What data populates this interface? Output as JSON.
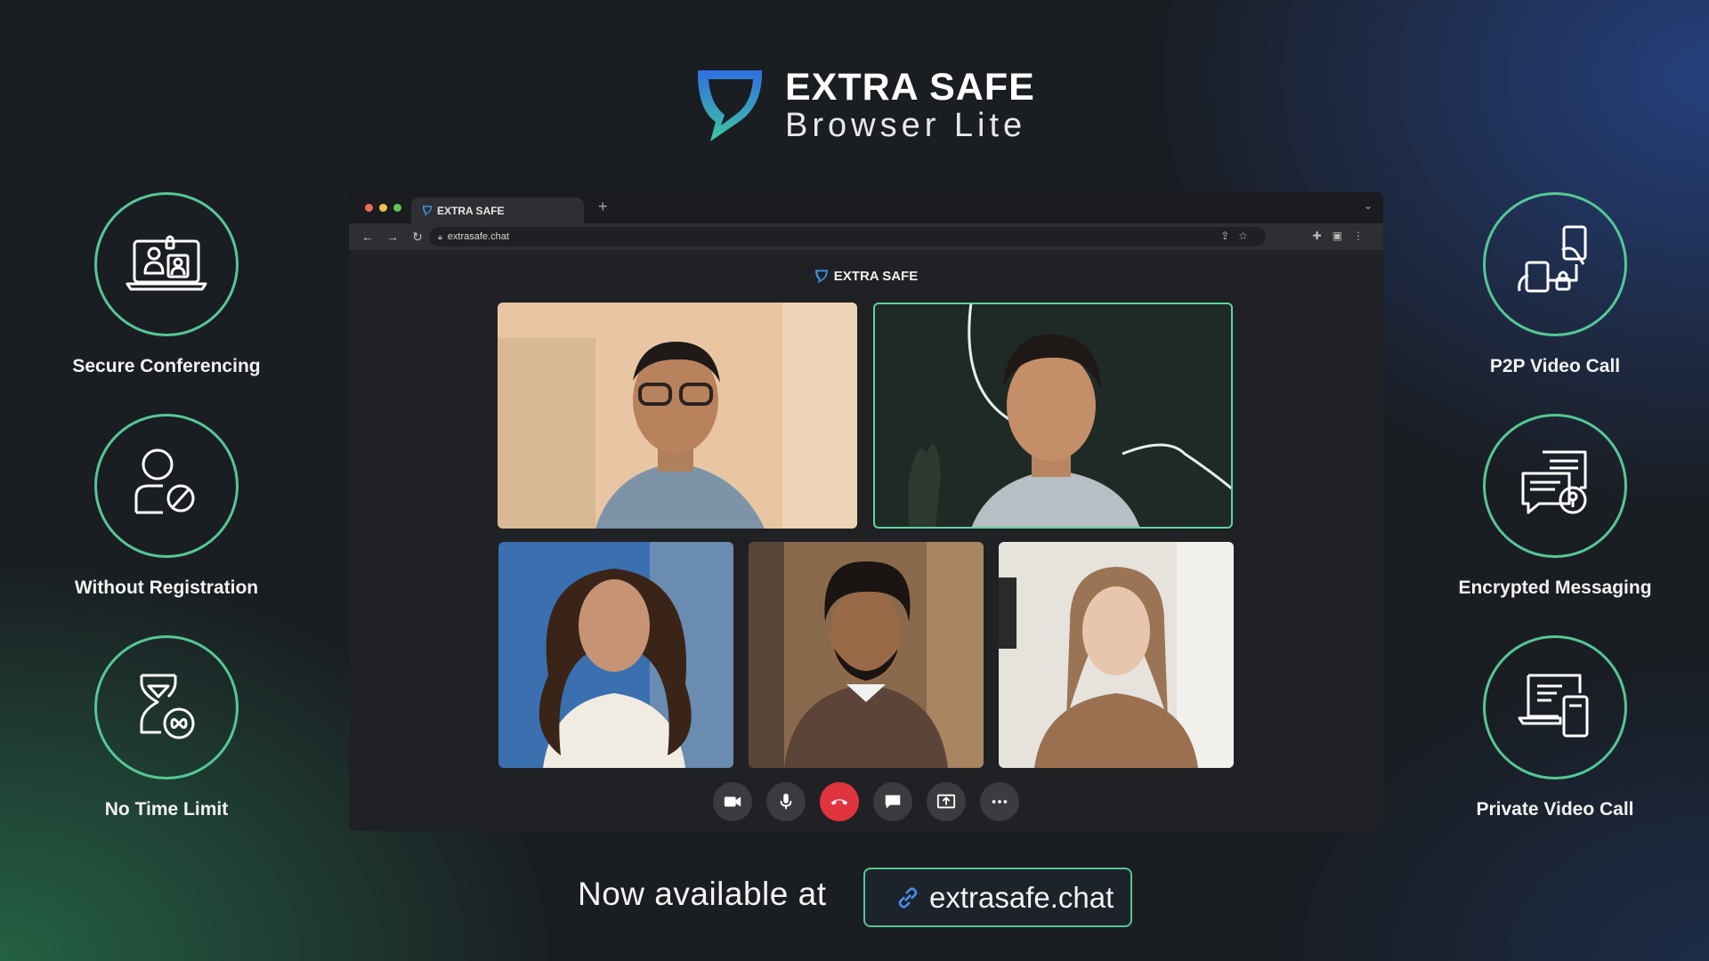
{
  "brand": {
    "name": "EXTRA SAFE",
    "subtitle": "Browser Lite"
  },
  "features_left": [
    {
      "label": "Secure Conferencing",
      "icon": "video-conference-icon"
    },
    {
      "label": "Without Registration",
      "icon": "user-block-icon"
    },
    {
      "label": "No Time Limit",
      "icon": "hourglass-infinity-icon"
    }
  ],
  "features_right": [
    {
      "label": "P2P Video Call",
      "icon": "p2p-devices-icon"
    },
    {
      "label": "Encrypted Messaging",
      "icon": "encrypted-chat-icon"
    },
    {
      "label": "Private Video Call",
      "icon": "private-devices-icon"
    }
  ],
  "browser": {
    "tab_title": "EXTRA SAFE",
    "new_tab": "+",
    "url": "extrasafe.chat",
    "app_title": "EXTRA SAFE"
  },
  "participants": [
    {
      "name": "participant-1",
      "active": false
    },
    {
      "name": "participant-2",
      "active": true
    },
    {
      "name": "participant-3",
      "active": false
    },
    {
      "name": "participant-4",
      "active": false
    },
    {
      "name": "participant-5",
      "active": false
    }
  ],
  "controls": [
    "camera-icon",
    "microphone-icon",
    "end-call-icon",
    "chat-icon",
    "share-screen-icon",
    "more-icon"
  ],
  "footer": {
    "text": "Now available at",
    "link": "extrasafe.chat"
  },
  "colors": {
    "accent": "#55c794",
    "end_call": "#e0343f",
    "background": "#1a1d22"
  }
}
